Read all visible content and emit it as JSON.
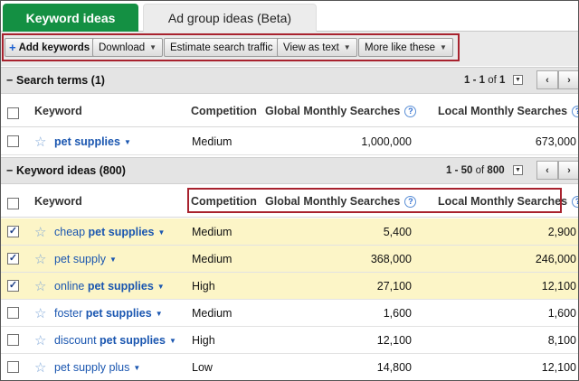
{
  "tabs": [
    {
      "label": "Keyword ideas",
      "active": true
    },
    {
      "label": "Ad group ideas (Beta)",
      "active": false
    }
  ],
  "toolbar": {
    "add_keywords": "Add keywords",
    "download": "Download",
    "estimate": "Estimate search traffic",
    "view_as_text": "View as text",
    "more_like_these": "More like these"
  },
  "search_terms": {
    "title": "Search terms (1)",
    "range": "1 - 1",
    "of_label": "of",
    "total": "1",
    "columns": [
      "Keyword",
      "Competition",
      "Global Monthly Searches",
      "Local Monthly Searches"
    ],
    "rows": [
      {
        "checked": false,
        "keyword_pre": "",
        "keyword_bold": "pet supplies",
        "keyword_post": "",
        "competition": "Medium",
        "global": "1,000,000",
        "local": "673,000"
      }
    ]
  },
  "keyword_ideas": {
    "title": "Keyword ideas (800)",
    "range": "1 - 50",
    "of_label": "of",
    "total": "800",
    "columns": [
      "Keyword",
      "Competition",
      "Global Monthly Searches",
      "Local Monthly Searches"
    ],
    "rows": [
      {
        "checked": true,
        "keyword_pre": "cheap ",
        "keyword_bold": "pet supplies",
        "keyword_post": "",
        "competition": "Medium",
        "global": "5,400",
        "local": "2,900"
      },
      {
        "checked": true,
        "keyword_pre": "pet supply",
        "keyword_bold": "",
        "keyword_post": "",
        "competition": "Medium",
        "global": "368,000",
        "local": "246,000"
      },
      {
        "checked": true,
        "keyword_pre": "online ",
        "keyword_bold": "pet supplies",
        "keyword_post": "",
        "competition": "High",
        "global": "27,100",
        "local": "12,100"
      },
      {
        "checked": false,
        "keyword_pre": "foster ",
        "keyword_bold": "pet supplies",
        "keyword_post": "",
        "competition": "Medium",
        "global": "1,600",
        "local": "1,600"
      },
      {
        "checked": false,
        "keyword_pre": "discount ",
        "keyword_bold": "pet supplies",
        "keyword_post": "",
        "competition": "High",
        "global": "12,100",
        "local": "8,100"
      },
      {
        "checked": false,
        "keyword_pre": "pet supply plus",
        "keyword_bold": "",
        "keyword_post": "",
        "competition": "Low",
        "global": "14,800",
        "local": "12,100"
      }
    ]
  },
  "colors": {
    "active_tab": "#149043",
    "link": "#1a56b0",
    "highlight_box": "#a8222e",
    "selected_row": "#fcf5c7"
  },
  "icons": {
    "star": "star-icon",
    "help": "help-icon",
    "dropdown": "chevron-down-icon",
    "prev": "chevron-left-icon",
    "next": "chevron-right-icon"
  }
}
